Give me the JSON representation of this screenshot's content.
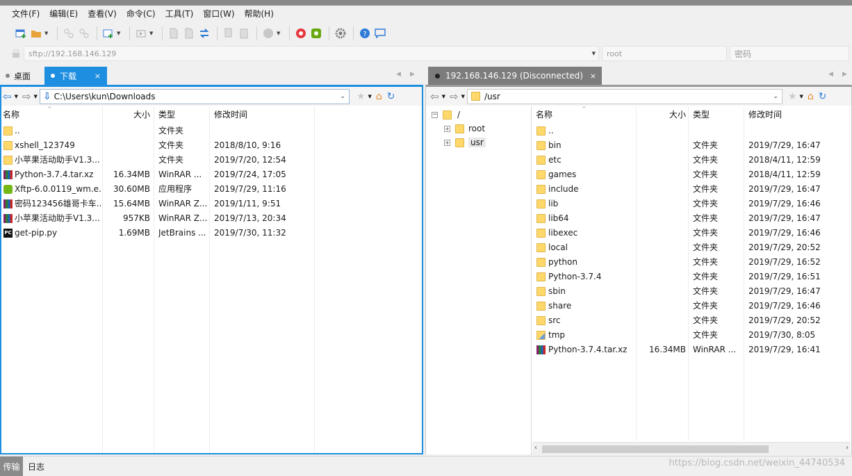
{
  "menu": {
    "items": [
      "文件(F)",
      "编辑(E)",
      "查看(V)",
      "命令(C)",
      "工具(T)",
      "窗口(W)",
      "帮助(H)"
    ]
  },
  "address": {
    "host": "sftp://192.168.146.129",
    "user": "root",
    "password_placeholder": "密码"
  },
  "left": {
    "tabs": [
      {
        "label": "桌面",
        "active": false
      },
      {
        "label": "下载",
        "active": true,
        "close": "×"
      }
    ],
    "path": "C:\\Users\\kun\\Downloads",
    "columns": [
      "名称",
      "大小",
      "类型",
      "修改时间"
    ],
    "files": [
      {
        "icon": "folder-icon",
        "name": "..",
        "size": "",
        "type": "文件夹",
        "modified": ""
      },
      {
        "icon": "folder-icon",
        "name": "xshell_123749",
        "size": "",
        "type": "文件夹",
        "modified": "2018/8/10, 9:16"
      },
      {
        "icon": "folder-icon",
        "name": "小苹果活动助手V1.3...",
        "size": "",
        "type": "文件夹",
        "modified": "2019/7/20, 12:54"
      },
      {
        "icon": "rar-icon",
        "name": "Python-3.7.4.tar.xz",
        "size": "16.34MB",
        "type": "WinRAR ...",
        "modified": "2019/7/24, 17:05"
      },
      {
        "icon": "xftp-exe-icon",
        "name": "Xftp-6.0.0119_wm.e...",
        "size": "30.60MB",
        "type": "应用程序",
        "modified": "2019/7/29, 11:16"
      },
      {
        "icon": "rar-icon",
        "name": "密码123456雄哥卡车...",
        "size": "15.64MB",
        "type": "WinRAR Z...",
        "modified": "2019/1/11, 9:51"
      },
      {
        "icon": "rar-icon",
        "name": "小苹果活动助手V1.3...",
        "size": "957KB",
        "type": "WinRAR Z...",
        "modified": "2019/7/13, 20:34"
      },
      {
        "icon": "pycharm-icon",
        "name": "get-pip.py",
        "size": "1.69MB",
        "type": "JetBrains ...",
        "modified": "2019/7/30, 11:32"
      }
    ]
  },
  "right": {
    "tab": {
      "label": "192.168.146.129 (Disconnected)",
      "close": "×"
    },
    "path": "/usr",
    "tree": {
      "root": "/",
      "children": [
        "root",
        "usr"
      ],
      "expander": "+"
    },
    "columns": [
      "名称",
      "大小",
      "类型",
      "修改时间"
    ],
    "files": [
      {
        "icon": "folder-icon",
        "name": "..",
        "size": "",
        "type": "",
        "modified": ""
      },
      {
        "icon": "folder-icon",
        "name": "bin",
        "size": "",
        "type": "文件夹",
        "modified": "2019/7/29, 16:47"
      },
      {
        "icon": "folder-icon",
        "name": "etc",
        "size": "",
        "type": "文件夹",
        "modified": "2018/4/11, 12:59"
      },
      {
        "icon": "folder-icon",
        "name": "games",
        "size": "",
        "type": "文件夹",
        "modified": "2018/4/11, 12:59"
      },
      {
        "icon": "folder-icon",
        "name": "include",
        "size": "",
        "type": "文件夹",
        "modified": "2019/7/29, 16:47"
      },
      {
        "icon": "folder-icon",
        "name": "lib",
        "size": "",
        "type": "文件夹",
        "modified": "2019/7/29, 16:46"
      },
      {
        "icon": "folder-icon",
        "name": "lib64",
        "size": "",
        "type": "文件夹",
        "modified": "2019/7/29, 16:47"
      },
      {
        "icon": "folder-icon",
        "name": "libexec",
        "size": "",
        "type": "文件夹",
        "modified": "2019/7/29, 16:46"
      },
      {
        "icon": "folder-icon",
        "name": "local",
        "size": "",
        "type": "文件夹",
        "modified": "2019/7/29, 20:52"
      },
      {
        "icon": "folder-icon",
        "name": "python",
        "size": "",
        "type": "文件夹",
        "modified": "2019/7/29, 16:52"
      },
      {
        "icon": "folder-icon",
        "name": "Python-3.7.4",
        "size": "",
        "type": "文件夹",
        "modified": "2019/7/29, 16:51"
      },
      {
        "icon": "folder-icon",
        "name": "sbin",
        "size": "",
        "type": "文件夹",
        "modified": "2019/7/29, 16:47"
      },
      {
        "icon": "folder-icon",
        "name": "share",
        "size": "",
        "type": "文件夹",
        "modified": "2019/7/29, 16:46"
      },
      {
        "icon": "folder-icon",
        "name": "src",
        "size": "",
        "type": "文件夹",
        "modified": "2019/7/29, 20:52"
      },
      {
        "icon": "symlink-folder-icon",
        "name": "tmp",
        "size": "",
        "type": "文件夹",
        "modified": "2019/7/30, 8:05"
      },
      {
        "icon": "rar-icon",
        "name": "Python-3.7.4.tar.xz",
        "size": "16.34MB",
        "type": "WinRAR ...",
        "modified": "2019/7/29, 16:41"
      }
    ]
  },
  "bottom": {
    "tabs": [
      "传输",
      "日志"
    ],
    "active": "传输"
  },
  "watermark": "https://blog.csdn.net/weixin_44740534",
  "colors": {
    "accent": "#1e8ee0",
    "folder": "#ffd86b",
    "tab_active": "#1e8ee0"
  }
}
